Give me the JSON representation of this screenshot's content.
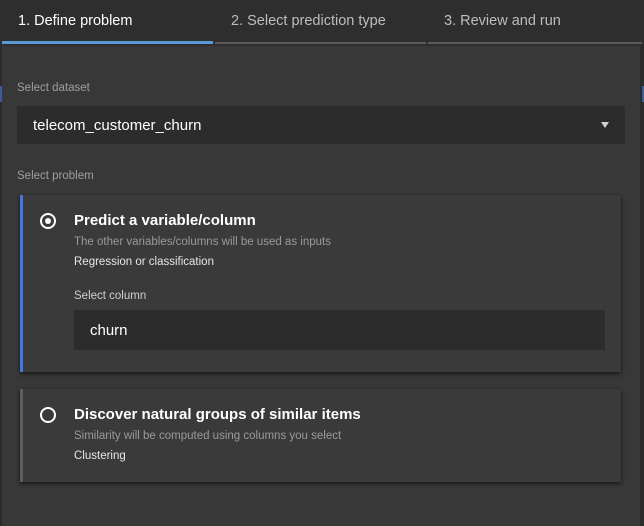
{
  "tabs": [
    {
      "label": "1. Define problem",
      "active": true
    },
    {
      "label": "2. Select prediction type",
      "active": false
    },
    {
      "label": "3. Review and run",
      "active": false
    }
  ],
  "dataset": {
    "label": "Select dataset",
    "value": "telecom_customer_churn"
  },
  "problem": {
    "label": "Select problem",
    "options": [
      {
        "title": "Predict a variable/column",
        "description": "The other variables/columns will be used as inputs",
        "type": "Regression or classification",
        "selected": true,
        "column_label": "Select column",
        "column_value": "churn"
      },
      {
        "title": "Discover natural groups of similar items",
        "description": "Similarity will be computed using columns you select",
        "type": "Clustering",
        "selected": false
      }
    ]
  },
  "colors": {
    "accent": "#4577e0",
    "active_tab_underline": "#5b9bd5",
    "background": "#2b2b2b",
    "panel": "#383838"
  }
}
